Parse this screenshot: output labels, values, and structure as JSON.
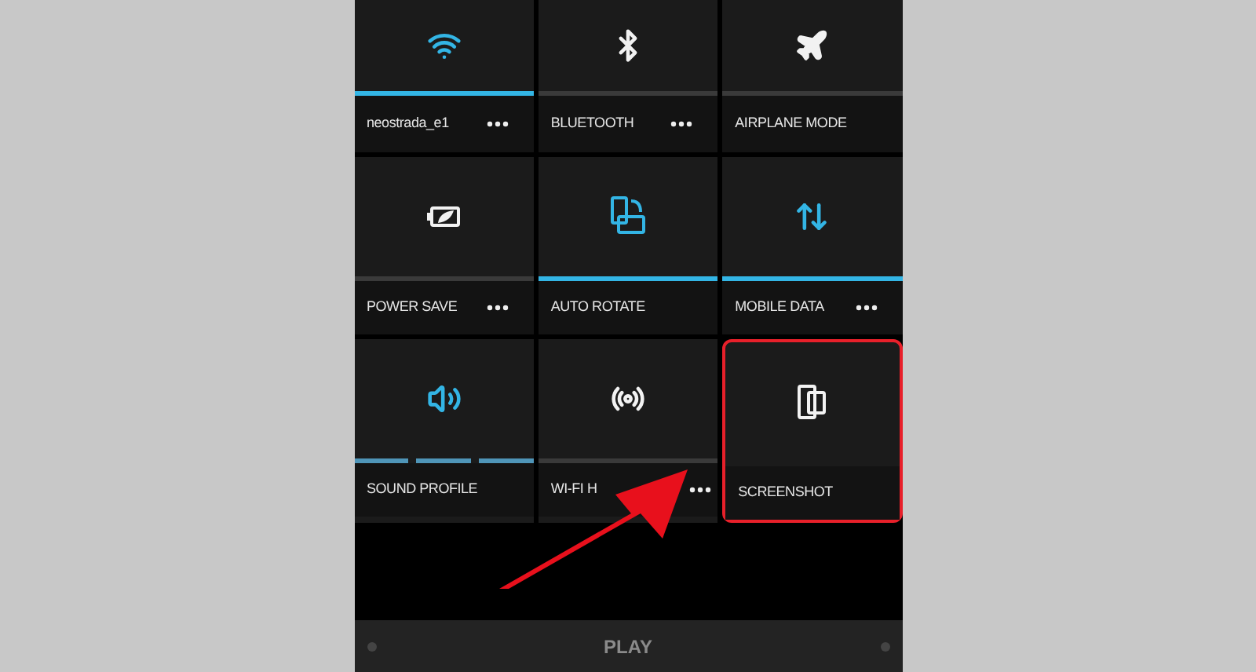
{
  "tiles": [
    {
      "kind": "wifi",
      "label": "neostrada_e1",
      "on": true,
      "segmented": false,
      "more": true,
      "highlighted": false
    },
    {
      "kind": "bluetooth",
      "label": "BLUETOOTH",
      "on": false,
      "segmented": false,
      "more": true,
      "highlighted": false
    },
    {
      "kind": "airplane",
      "label": "AIRPLANE MODE",
      "on": false,
      "segmented": false,
      "more": false,
      "highlighted": false
    },
    {
      "kind": "battery",
      "label": "POWER SAVE",
      "on": false,
      "segmented": false,
      "more": true,
      "highlighted": false
    },
    {
      "kind": "rotate",
      "label": "AUTO ROTATE",
      "on": true,
      "segmented": false,
      "more": false,
      "highlighted": false
    },
    {
      "kind": "data",
      "label": "MOBILE DATA",
      "on": true,
      "segmented": false,
      "more": true,
      "highlighted": false
    },
    {
      "kind": "sound",
      "label": "SOUND PROFILE",
      "on": true,
      "segmented": true,
      "more": false,
      "highlighted": false
    },
    {
      "kind": "hotspot",
      "label": "WI-FI H",
      "on": false,
      "segmented": false,
      "more": true,
      "highlighted": false
    },
    {
      "kind": "screenshot",
      "label": "SCREENSHOT",
      "highlighted": true
    }
  ],
  "bottom_bar": {
    "label": "PLAY"
  }
}
